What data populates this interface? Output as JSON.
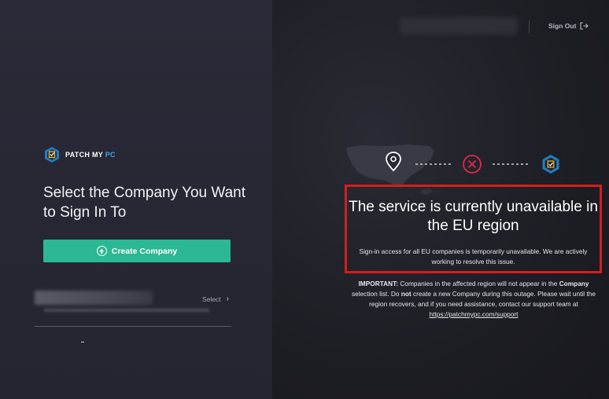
{
  "logo": {
    "text_main": "PATCH MY ",
    "text_accent": "PC"
  },
  "page_title": "Select the Company You Want to Sign In To",
  "create_button": {
    "label": "Create Company",
    "icon": "plus-circle-icon"
  },
  "company_list": [
    {
      "action_label": "Select",
      "action_icon": "chevron-right-icon"
    }
  ],
  "header": {
    "signout_label": "Sign Out",
    "signout_icon": "sign-out-icon"
  },
  "status_graphic": {
    "icons": [
      "location-pin-icon",
      "error-x-icon",
      "patchmypc-badge-icon"
    ],
    "error_color": "#e0294a"
  },
  "alert": {
    "headline": "The service is currently unavailable in the EU region",
    "message": "Sign-in access for all EU companies is temporarily unavailable. We are actively working to resolve this issue.",
    "border_color": "#d21f1f"
  },
  "notice": {
    "label": "IMPORTANT:",
    "part1": " Companies in the affected region will not appear in the ",
    "bold1": "Company",
    "part2": " selection list. Do ",
    "bold2": "not",
    "part3": " create a new Company during this outage. Please wait until the region recovers, and if you need assistance, contact our support team at ",
    "link": "https://patchmypc.com/support"
  },
  "colors": {
    "accent": "#2bb894",
    "brand_blue": "#3aa8e0"
  }
}
